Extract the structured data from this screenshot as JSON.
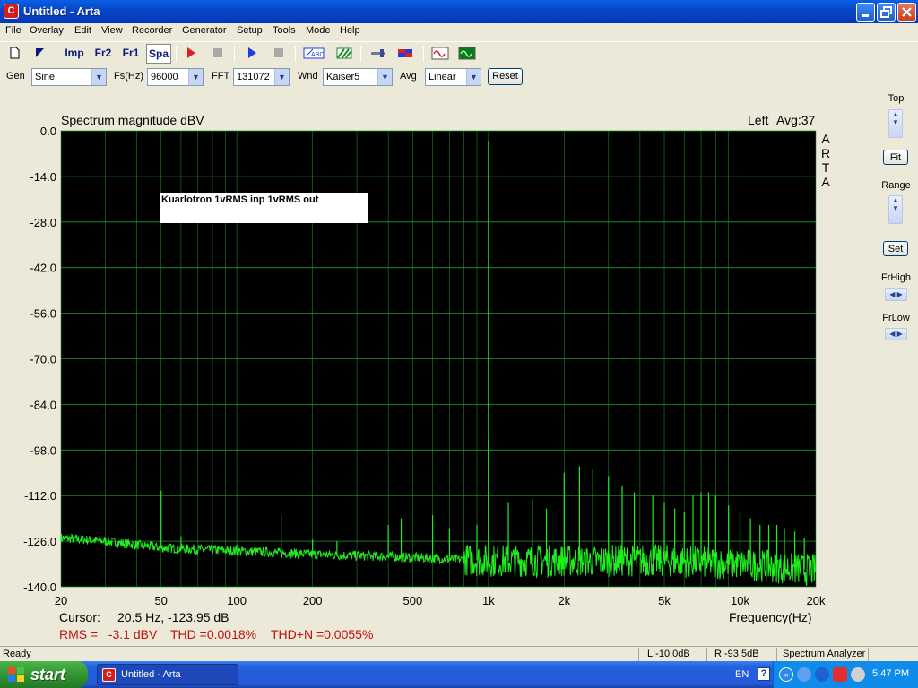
{
  "window": {
    "title": "Untitled - Arta",
    "icon": "arta-app-icon",
    "icon_glyph": "C"
  },
  "menu": [
    "File",
    "Overlay",
    "Edit",
    "View",
    "Recorder",
    "Generator",
    "Setup",
    "Tools",
    "Mode",
    "Help"
  ],
  "toolbar_text": {
    "imp": "Imp",
    "fr2": "Fr2",
    "fr1": "Fr1",
    "spa": "Spa"
  },
  "controls": {
    "gen_label": "Gen",
    "gen_value": "Sine",
    "fs_label": "Fs(Hz)",
    "fs_value": "96000",
    "fft_label": "FFT",
    "fft_value": "131072",
    "wnd_label": "Wnd",
    "wnd_value": "Kaiser5",
    "avg_label": "Avg",
    "avg_value": "Linear",
    "reset_label": "Reset"
  },
  "right_panel": {
    "top_label": "Top",
    "fit_label": "Fit",
    "range_label": "Range",
    "set_label": "Set",
    "frhigh_label": "FrHigh",
    "frlow_label": "FrLow"
  },
  "status": {
    "ready": "Ready",
    "left_level": "L:-10.0dB",
    "right_level": "R:-93.5dB",
    "mode": "Spectrum Analyzer"
  },
  "taskbar": {
    "start": "start",
    "task": "Untitled - Arta",
    "lang": "EN",
    "clock": "5:47 PM"
  },
  "colors": {
    "plot_bg": "#000000",
    "grid": "#1f9a28",
    "trace": "#1ef01e",
    "info_red": "#c01010",
    "titlebar": "#0a5fe6"
  },
  "chart_data": {
    "type": "line",
    "title": "Spectrum magnitude dBV",
    "channel_label": "Left",
    "avg_label": "Avg:37",
    "brand": "ARTA",
    "annotation": "Kuarlotron 1vRMS inp  1vRMS out",
    "xlabel": "Frequency(Hz)",
    "x_scale": "log",
    "xlim": [
      20,
      20000
    ],
    "ylim": [
      -140,
      0
    ],
    "y_ticks": [
      0,
      -14,
      -28,
      -42,
      -56,
      -70,
      -84,
      -98,
      -112,
      -126,
      -140
    ],
    "y_tick_labels": [
      "0.0",
      "-14.0",
      "-28.0",
      "-42.0",
      "-56.0",
      "-70.0",
      "-84.0",
      "-98.0",
      "-112.0",
      "-126.0",
      "-140.0"
    ],
    "x_ticks": [
      20,
      50,
      100,
      200,
      500,
      1000,
      2000,
      5000,
      10000,
      20000
    ],
    "x_tick_labels": [
      "20",
      "50",
      "100",
      "200",
      "500",
      "1k",
      "2k",
      "5k",
      "10k",
      "20k"
    ],
    "grid": true,
    "cursor_label": "Cursor:",
    "cursor_value": "20.5 Hz, -123.95 dB",
    "rms_text": "RMS =   -3.1 dBV",
    "thd_text": "THD =0.0018%",
    "thdn_text": "THD+N =0.0055%",
    "noise_floor": [
      [
        20,
        -125
      ],
      [
        30,
        -126
      ],
      [
        50,
        -128
      ],
      [
        100,
        -129
      ],
      [
        200,
        -130
      ],
      [
        500,
        -131
      ],
      [
        1000,
        -132
      ],
      [
        2000,
        -132
      ],
      [
        5000,
        -132
      ],
      [
        10000,
        -133
      ],
      [
        20000,
        -135
      ]
    ],
    "peaks": [
      {
        "f": 50,
        "db": -110.5
      },
      {
        "f": 60,
        "db": -124.5
      },
      {
        "f": 100,
        "db": -127
      },
      {
        "f": 150,
        "db": -118
      },
      {
        "f": 200,
        "db": -125.5
      },
      {
        "f": 250,
        "db": -126
      },
      {
        "f": 400,
        "db": -121
      },
      {
        "f": 450,
        "db": -119
      },
      {
        "f": 600,
        "db": -118
      },
      {
        "f": 700,
        "db": -122
      },
      {
        "f": 900,
        "db": -121
      },
      {
        "f": 1000,
        "db": -3
      },
      {
        "f": 1000,
        "db": -95
      },
      {
        "f": 1200,
        "db": -114
      },
      {
        "f": 1500,
        "db": -113
      },
      {
        "f": 1700,
        "db": -116
      },
      {
        "f": 2000,
        "db": -105
      },
      {
        "f": 2300,
        "db": -103
      },
      {
        "f": 2600,
        "db": -104
      },
      {
        "f": 3000,
        "db": -106
      },
      {
        "f": 3400,
        "db": -109
      },
      {
        "f": 3800,
        "db": -111
      },
      {
        "f": 4500,
        "db": -112
      },
      {
        "f": 5000,
        "db": -114
      },
      {
        "f": 5500,
        "db": -116
      },
      {
        "f": 6000,
        "db": -117
      },
      {
        "f": 6500,
        "db": -112
      },
      {
        "f": 7000,
        "db": -111
      },
      {
        "f": 7500,
        "db": -111
      },
      {
        "f": 8000,
        "db": -112
      },
      {
        "f": 9000,
        "db": -115
      },
      {
        "f": 10000,
        "db": -117
      },
      {
        "f": 11000,
        "db": -119
      },
      {
        "f": 12000,
        "db": -121
      },
      {
        "f": 13000,
        "db": -121
      },
      {
        "f": 14000,
        "db": -121
      },
      {
        "f": 15000,
        "db": -122
      },
      {
        "f": 16500,
        "db": -123
      },
      {
        "f": 18000,
        "db": -125
      }
    ]
  }
}
